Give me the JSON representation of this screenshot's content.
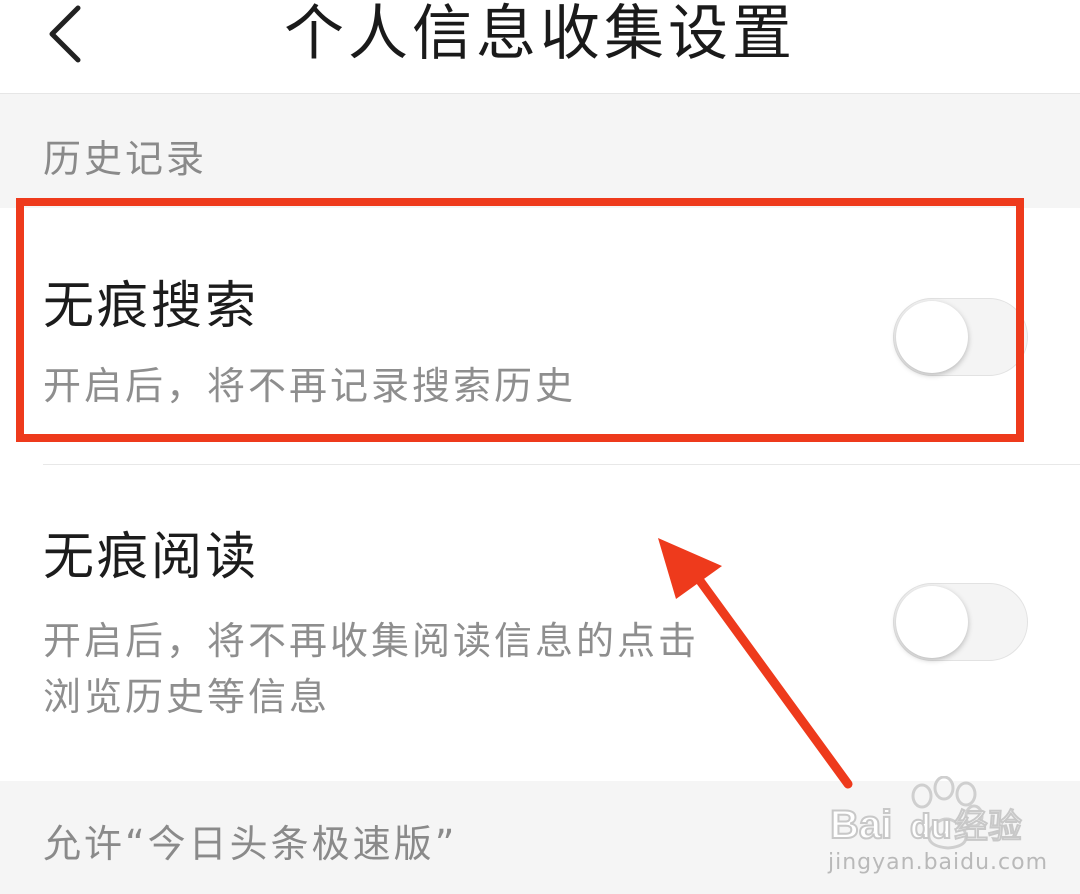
{
  "header": {
    "title": "个人信息收集设置",
    "back_icon": "chevron-left-icon"
  },
  "sections": {
    "history_label": "历史记录",
    "allow_label": "允许“今日头条极速版”"
  },
  "settings": {
    "incognito_search": {
      "title": "无痕搜索",
      "description": "开启后，将不再记录搜索历史",
      "enabled": false
    },
    "incognito_reading": {
      "title": "无痕阅读",
      "description_line1": "开启后，将不再收集阅读信息的点击",
      "description_line2": "浏览历史等信息",
      "enabled": false
    }
  },
  "annotation": {
    "highlight_color": "#ee3a1c",
    "arrow_color": "#ee3a1c"
  },
  "watermark": {
    "logo_text": "Baidu经验",
    "domain": "jingyan.baidu.com"
  }
}
